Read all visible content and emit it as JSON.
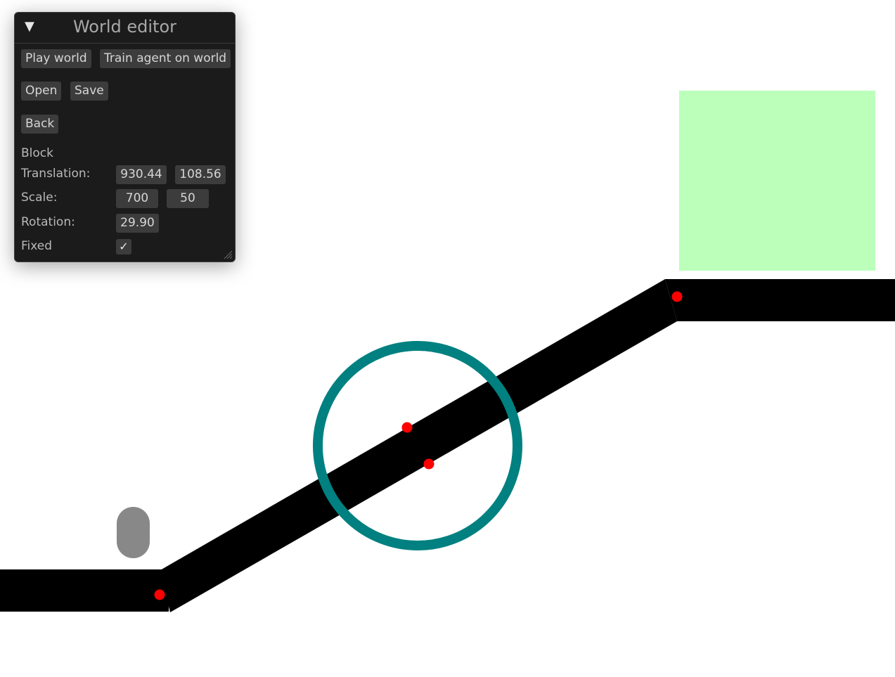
{
  "window": {
    "title": "World editor",
    "collapse_icon": "▼"
  },
  "buttons": {
    "play_world": "Play world",
    "train_agent": "Train agent on world",
    "open": "Open",
    "save": "Save",
    "back": "Back"
  },
  "inspector": {
    "section_title": "Block",
    "translation_label": "Translation:",
    "translation_x": "930.44",
    "translation_y": "108.56",
    "scale_label": "Scale:",
    "scale_x": "700",
    "scale_y": "50",
    "rotation_label": "Rotation:",
    "rotation": "29.90",
    "fixed_label": "Fixed",
    "fixed_checked": true,
    "check_glyph": "✓"
  },
  "colors": {
    "block": "#000000",
    "goal": "#bbffbb",
    "circle": "#008080",
    "agent": "#888888",
    "handle": "#ff0000",
    "panel_bg": "#1b1b1b",
    "widget_bg": "#3c3c3c"
  }
}
